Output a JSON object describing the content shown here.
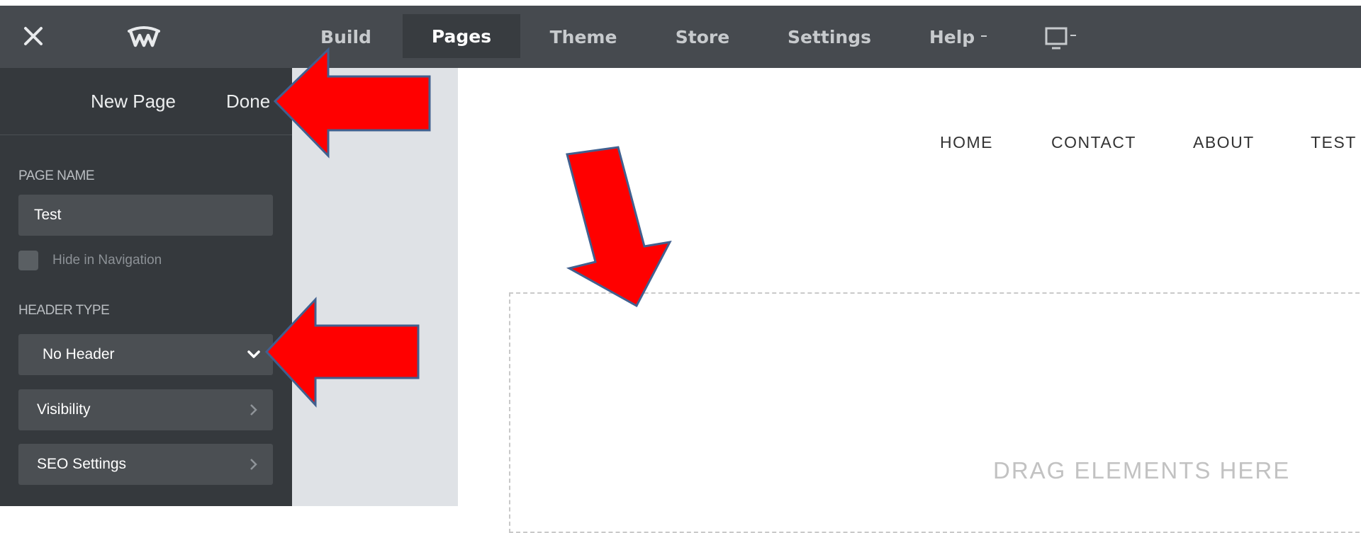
{
  "toolbar": {
    "close_icon": "close-icon",
    "logo_icon": "weebly-logo-icon",
    "tabs": [
      {
        "label": "Build"
      },
      {
        "label": "Pages"
      },
      {
        "label": "Theme"
      },
      {
        "label": "Store"
      },
      {
        "label": "Settings"
      },
      {
        "label": "Help"
      }
    ],
    "active_tab": "Pages",
    "device_icon": "desktop-monitor-icon"
  },
  "sidebar": {
    "new_page_label": "New Page",
    "done_label": "Done",
    "page_name_heading": "PAGE NAME",
    "page_name_value": "Test",
    "hide_in_nav_label": "Hide in Navigation",
    "hide_in_nav_checked": false,
    "header_type_heading": "HEADER TYPE",
    "header_type_value": "No Header",
    "visibility_label": "Visibility",
    "seo_label": "SEO Settings"
  },
  "site": {
    "menu": [
      {
        "label": "HOME"
      },
      {
        "label": "CONTACT"
      },
      {
        "label": "ABOUT"
      },
      {
        "label": "TEST"
      }
    ],
    "drop_text": "DRAG ELEMENTS HERE"
  },
  "annotations": {
    "arrow_color": "#ff0000",
    "arrow_outline": "#41608f"
  },
  "colors": {
    "topbar_bg": "#464a4f",
    "active_tab_bg": "#383c40",
    "sidebar_bg": "#35393d",
    "field_bg": "#4b4f53"
  }
}
